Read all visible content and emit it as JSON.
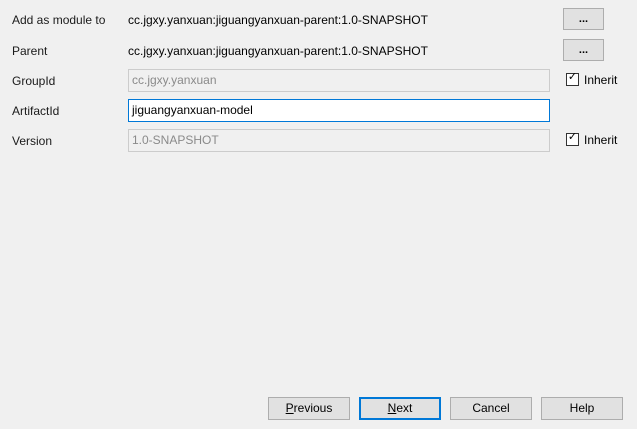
{
  "form": {
    "module": {
      "label": "Add as module to",
      "value": "cc.jgxy.yanxuan:jiguangyanxuan-parent:1.0-SNAPSHOT",
      "button": "..."
    },
    "parent": {
      "label": "Parent",
      "value": "cc.jgxy.yanxuan:jiguangyanxuan-parent:1.0-SNAPSHOT",
      "button": "..."
    },
    "groupId": {
      "label": "GroupId",
      "value": "cc.jgxy.yanxuan",
      "inherit_label": "Inherit",
      "inherit_checked": true
    },
    "artifactId": {
      "label": "ArtifactId",
      "value": "jiguangyanxuan-model"
    },
    "version": {
      "label": "Version",
      "value": "1.0-SNAPSHOT",
      "inherit_label": "Inherit",
      "inherit_checked": true
    }
  },
  "buttons": {
    "previous": {
      "mnemonic": "P",
      "rest": "revious"
    },
    "next": {
      "mnemonic": "N",
      "rest": "ext"
    },
    "cancel": "Cancel",
    "help": "Help"
  },
  "icons": {
    "checkbox_check": "checkmark-icon"
  },
  "colors": {
    "focus_border": "#0078d7",
    "window_bg": "#f0f0f0",
    "button_bg": "#e1e1e1"
  }
}
